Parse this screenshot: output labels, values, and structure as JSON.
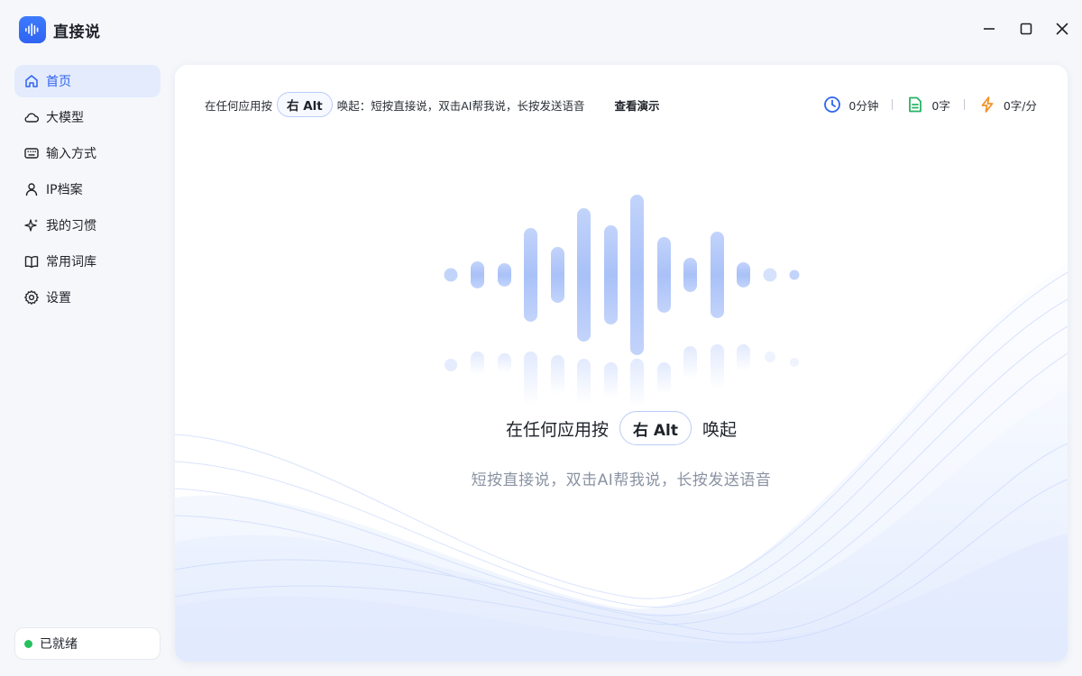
{
  "app": {
    "title": "直接说"
  },
  "window_controls": {
    "minimize": "minimize-icon",
    "maximize": "maximize-icon",
    "close": "close-icon"
  },
  "sidebar": {
    "items": [
      {
        "label": "首页",
        "icon": "home-icon",
        "active": true
      },
      {
        "label": "大模型",
        "icon": "cloud-icon"
      },
      {
        "label": "输入方式",
        "icon": "keyboard-icon"
      },
      {
        "label": "IP档案",
        "icon": "user-icon"
      },
      {
        "label": "我的习惯",
        "icon": "sparkle-icon"
      },
      {
        "label": "常用词库",
        "icon": "book-icon"
      },
      {
        "label": "设置",
        "icon": "gear-icon"
      }
    ],
    "status": {
      "label": "已就绪",
      "color": "#27c05e"
    }
  },
  "info_bar": {
    "prefix": "在任何应用按",
    "key": "右 Alt",
    "suffix": "唤起：短按直接说，双击AI帮我说，长按发送语音",
    "demo_link": "查看演示"
  },
  "stats": {
    "duration": "0分钟",
    "words": "0字",
    "speed": "0字/分"
  },
  "hero": {
    "prefix": "在任何应用按",
    "key": "右 Alt",
    "suffix": "唤起",
    "subtitle": "短按直接说，双击AI帮我说，长按发送语音"
  },
  "colors": {
    "accent": "#2f63f2",
    "active_bg": "#e3ebfd",
    "clock_icon": "#2f63f2",
    "doc_icon": "#27b466",
    "bolt_icon": "#f4932a"
  }
}
